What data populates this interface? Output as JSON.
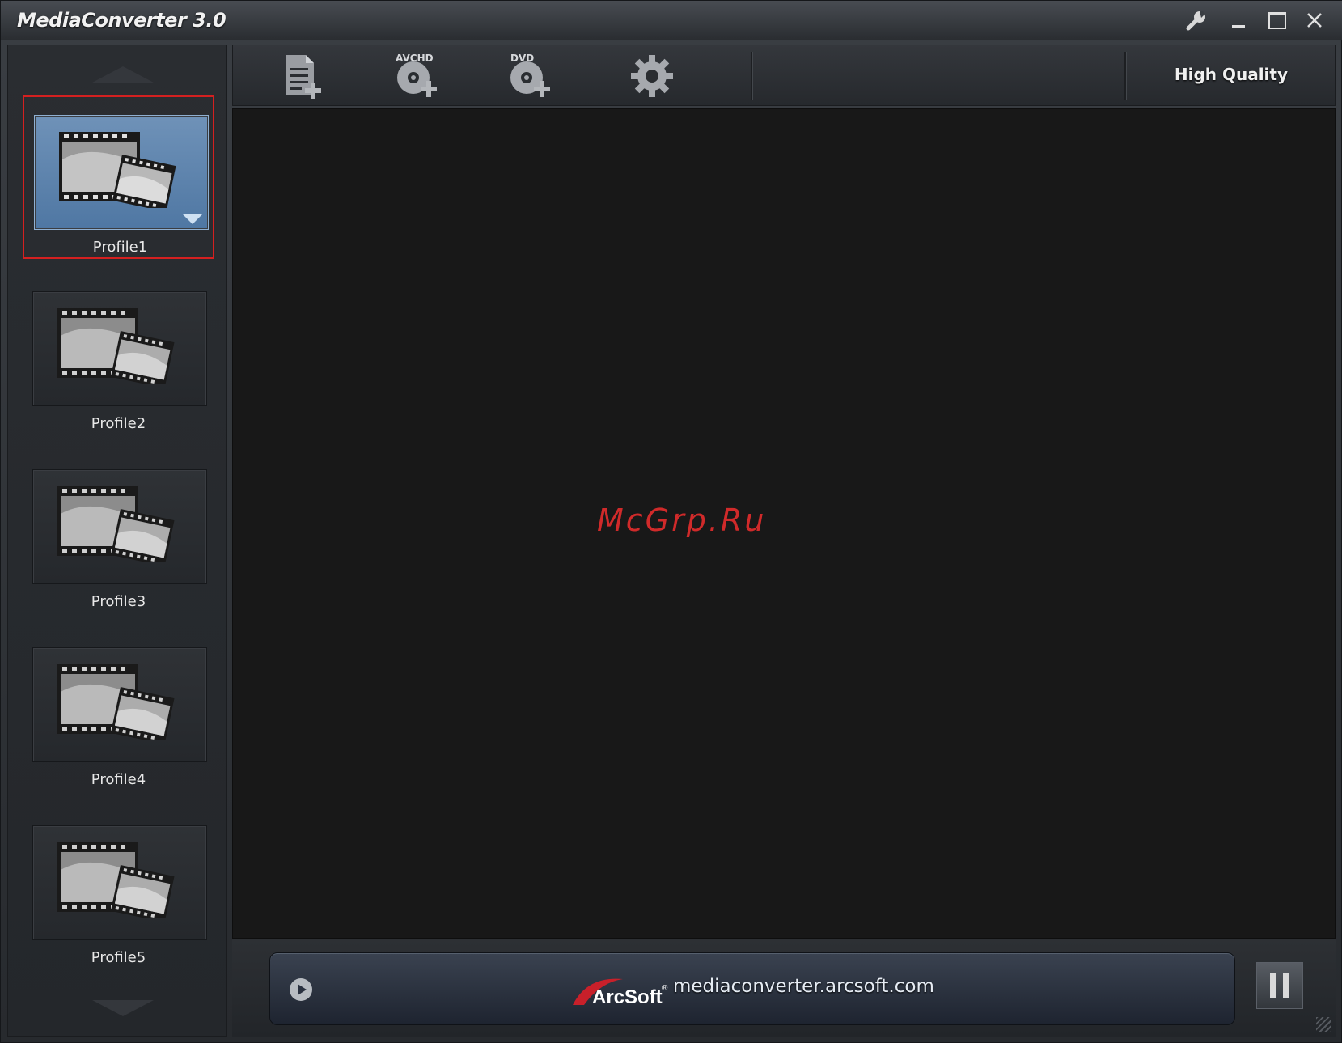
{
  "window": {
    "title": "MediaConverter 3.0",
    "controls": [
      "wrench-icon",
      "minimize-icon",
      "maximize-icon",
      "close-icon"
    ]
  },
  "toolbar": {
    "tools": [
      {
        "name": "add-file",
        "icon": "add-file-icon"
      },
      {
        "name": "add-avchd",
        "icon": "avchd-disc-add-icon",
        "badge": "AVCHD"
      },
      {
        "name": "add-dvd",
        "icon": "dvd-disc-add-icon",
        "badge": "DVD"
      },
      {
        "name": "settings",
        "icon": "gear-icon"
      }
    ],
    "quality": "High Quality"
  },
  "sidebar": {
    "profiles": [
      {
        "label": "Profile1",
        "selected": true
      },
      {
        "label": "Profile2",
        "selected": false
      },
      {
        "label": "Profile3",
        "selected": false
      },
      {
        "label": "Profile4",
        "selected": false
      },
      {
        "label": "Profile5",
        "selected": false
      }
    ]
  },
  "main": {
    "watermark": "McGrp.Ru"
  },
  "bottom": {
    "brand": "ArcSoft",
    "brand_mark": "®",
    "site": "mediaconverter.arcsoft.com"
  },
  "colors": {
    "selection_border": "#d42020",
    "selected_thumb": "#5b82ad",
    "watermark": "#d02a2a",
    "logo_red": "#c8202a"
  }
}
